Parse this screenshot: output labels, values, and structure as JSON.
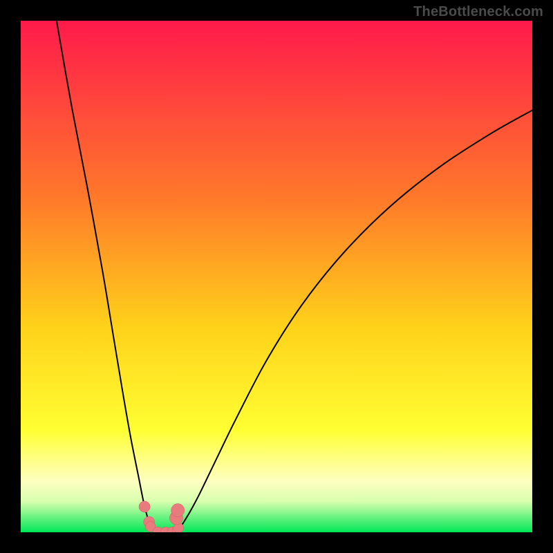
{
  "watermark": "TheBottleneck.com",
  "colors": {
    "frame": "#000000",
    "grad_top": "#ff1a4b",
    "grad_mid1": "#ff7a2a",
    "grad_mid2": "#ffd21a",
    "grad_yellow": "#ffff33",
    "grad_palegreen": "#d8ffae",
    "grad_green": "#00e756",
    "curve": "#000000",
    "marker_fill": "#e77b7d",
    "marker_stroke": "#d85a60"
  },
  "chart_data": {
    "type": "line",
    "title": "",
    "xlabel": "",
    "ylabel": "",
    "xlim": [
      0,
      100
    ],
    "ylim": [
      0,
      100
    ],
    "series": [
      {
        "name": "left-branch",
        "x": [
          7,
          10,
          13,
          16,
          18,
          20,
          21.5,
          23,
          24,
          24.7,
          25.2,
          25.6,
          26,
          26.3
        ],
        "y": [
          100,
          83,
          67.5,
          51,
          39,
          27,
          18.5,
          11,
          6,
          3.2,
          1.7,
          0.8,
          0.3,
          0.05
        ]
      },
      {
        "name": "right-branch",
        "x": [
          30.2,
          30.6,
          31.2,
          32,
          33.2,
          35,
          38,
          42,
          48,
          55,
          63,
          72,
          82,
          92,
          100
        ],
        "y": [
          0.05,
          0.3,
          1.0,
          2.2,
          4.2,
          7.6,
          13.8,
          22,
          33.5,
          44.5,
          54.5,
          63.5,
          71.5,
          78,
          82.5
        ]
      }
    ],
    "flat_bottom": {
      "x": [
        26.3,
        30.2
      ],
      "y": [
        0.05,
        0.05
      ]
    },
    "markers": [
      {
        "x": 24.2,
        "y": 5.0,
        "r": 1.1
      },
      {
        "x": 25.1,
        "y": 2.0,
        "r": 1.1
      },
      {
        "x": 25.35,
        "y": 1.1,
        "r": 1.0
      },
      {
        "x": 26.8,
        "y": 0.05,
        "r": 1.0
      },
      {
        "x": 28.3,
        "y": 0.05,
        "r": 1.0
      },
      {
        "x": 29.6,
        "y": 0.05,
        "r": 1.0
      },
      {
        "x": 30.6,
        "y": 0.4,
        "r": 1.0
      },
      {
        "x": 30.85,
        "y": 0.85,
        "r": 1.0
      },
      {
        "x": 30.4,
        "y": 2.8,
        "r": 1.3
      },
      {
        "x": 30.7,
        "y": 4.3,
        "r": 1.3
      }
    ]
  }
}
